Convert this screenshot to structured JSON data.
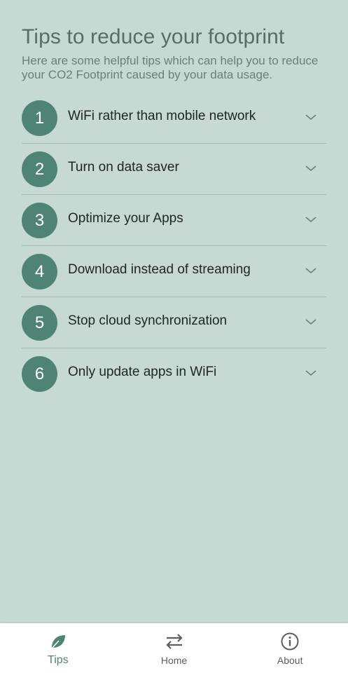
{
  "header": {
    "title": "Tips to reduce your footprint",
    "subtitle": "Here are some helpful tips which can help you to reduce your CO2 Footprint caused by your data usage."
  },
  "tips": [
    {
      "number": "1",
      "label": "WiFi rather than mobile network"
    },
    {
      "number": "2",
      "label": "Turn on data saver"
    },
    {
      "number": "3",
      "label": "Optimize your Apps"
    },
    {
      "number": "4",
      "label": "Download instead of streaming"
    },
    {
      "number": "5",
      "label": "Stop cloud synchronization"
    },
    {
      "number": "6",
      "label": "Only update apps in WiFi"
    }
  ],
  "bottom_nav": {
    "items": [
      {
        "label": "Tips",
        "icon": "leaf-icon",
        "active": true
      },
      {
        "label": "Home",
        "icon": "swap-arrows-icon",
        "active": false
      },
      {
        "label": "About",
        "icon": "info-icon",
        "active": false
      }
    ]
  },
  "colors": {
    "background": "#c6d9d3",
    "accent": "#4f8474",
    "nav_background": "#ffffff"
  }
}
